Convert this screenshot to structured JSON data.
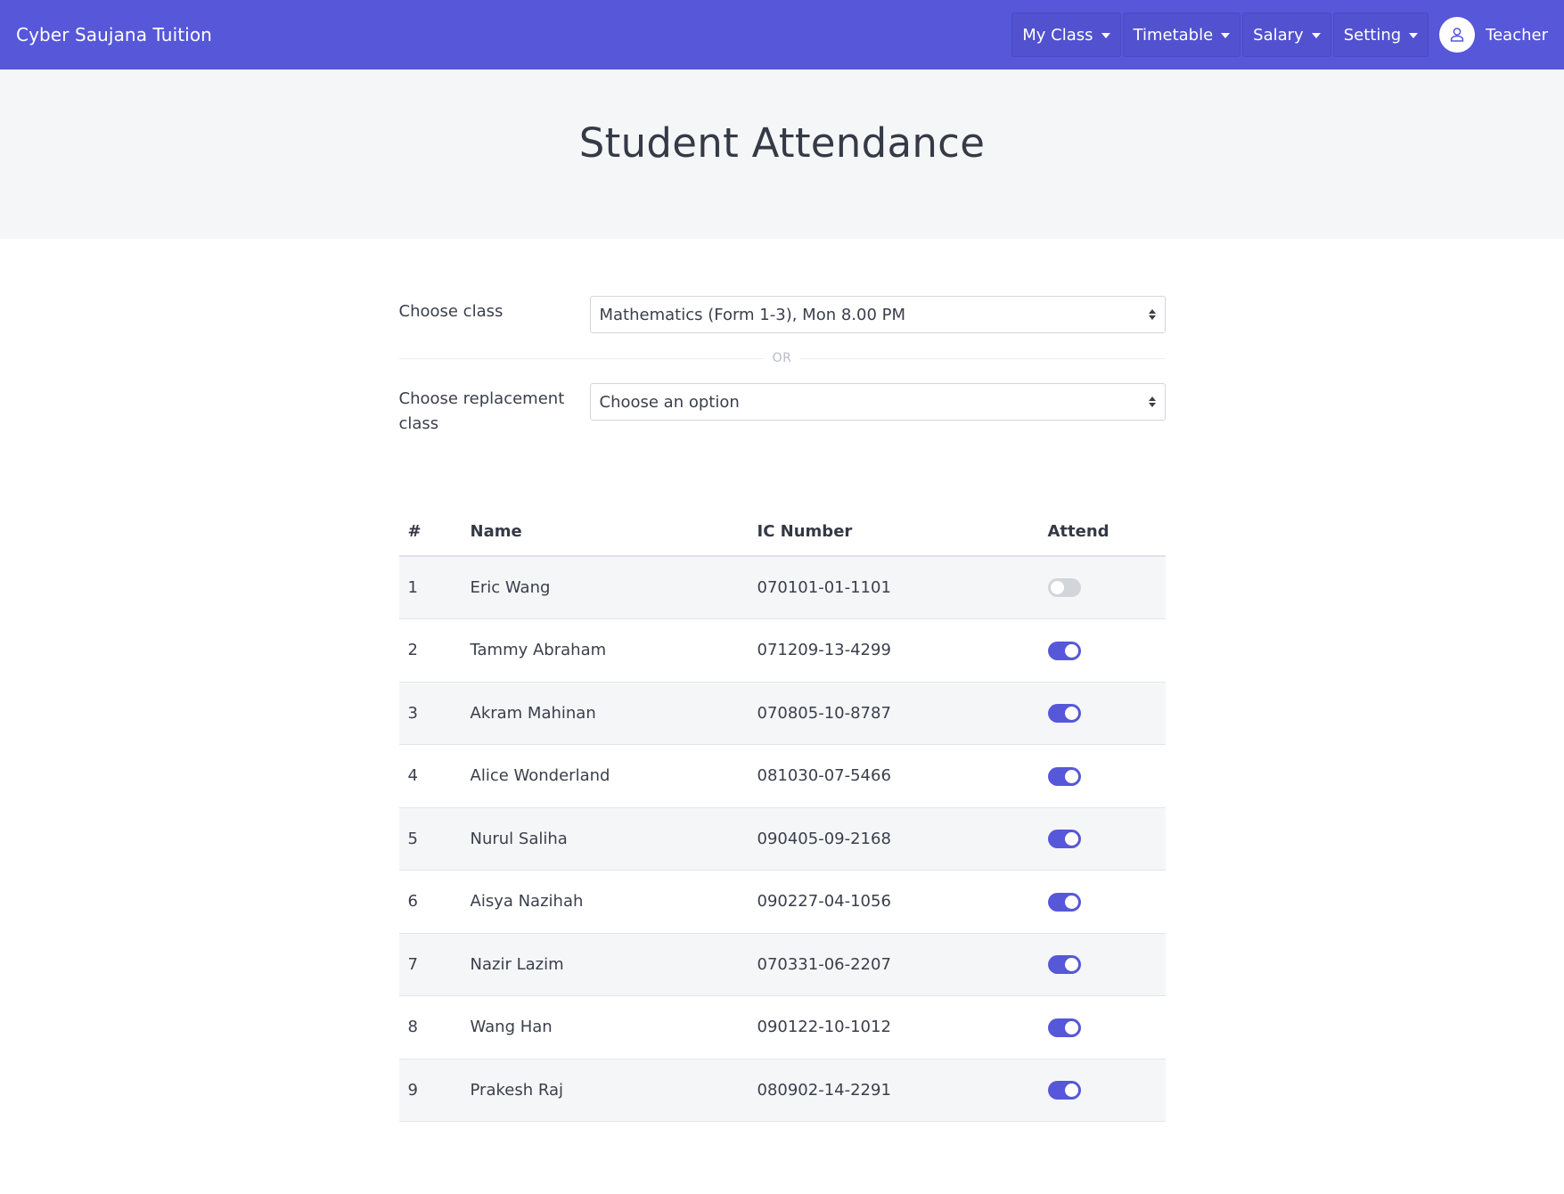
{
  "navbar": {
    "brand": "Cyber Saujana Tuition",
    "menu": [
      {
        "label": "My Class"
      },
      {
        "label": "Timetable"
      },
      {
        "label": "Salary"
      },
      {
        "label": "Setting"
      }
    ],
    "user": {
      "label": "Teacher",
      "icon": "user-icon"
    },
    "accent_color": "#5757d9"
  },
  "page": {
    "title": "Student Attendance"
  },
  "form": {
    "class_label": "Choose class",
    "class_value": "Mathematics (Form 1-3), Mon 8.00 PM",
    "divider": "OR",
    "replacement_label": "Choose replacement class",
    "replacement_value": "Choose an option"
  },
  "table": {
    "headers": [
      "#",
      "Name",
      "IC Number",
      "Attend"
    ],
    "rows": [
      {
        "num": "1",
        "name": "Eric Wang",
        "ic": "070101-01-1101",
        "attend": false
      },
      {
        "num": "2",
        "name": "Tammy Abraham",
        "ic": "071209-13-4299",
        "attend": true
      },
      {
        "num": "3",
        "name": "Akram Mahinan",
        "ic": "070805-10-8787",
        "attend": true
      },
      {
        "num": "4",
        "name": "Alice Wonderland",
        "ic": "081030-07-5466",
        "attend": true
      },
      {
        "num": "5",
        "name": "Nurul Saliha",
        "ic": "090405-09-2168",
        "attend": true
      },
      {
        "num": "6",
        "name": "Aisya Nazihah",
        "ic": "090227-04-1056",
        "attend": true
      },
      {
        "num": "7",
        "name": "Nazir Lazim",
        "ic": "070331-06-2207",
        "attend": true
      },
      {
        "num": "8",
        "name": "Wang Han",
        "ic": "090122-10-1012",
        "attend": true
      },
      {
        "num": "9",
        "name": "Prakesh Raj",
        "ic": "080902-14-2291",
        "attend": true
      }
    ]
  }
}
